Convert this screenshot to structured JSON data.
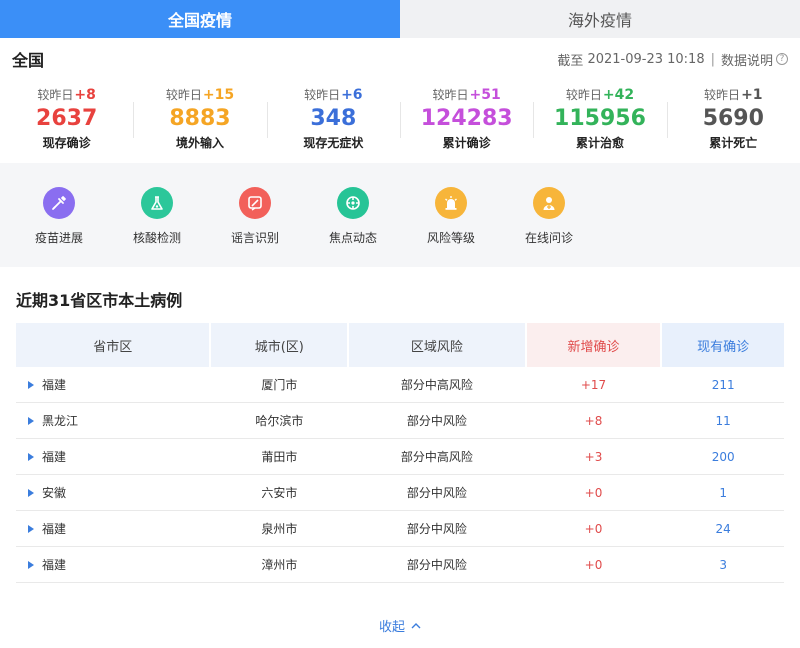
{
  "tabs": [
    {
      "label": "全国疫情",
      "active": true
    },
    {
      "label": "海外疫情",
      "active": false
    }
  ],
  "summary": {
    "region": "全国",
    "update_prefix": "截至",
    "update_time": "2021-09-23 10:18",
    "data_note": "数据说明",
    "delta_prefix": "较昨日"
  },
  "stats": [
    {
      "label": "现存确诊",
      "value": "2637",
      "delta": "+8",
      "color": "#e8423e"
    },
    {
      "label": "境外输入",
      "value": "8883",
      "delta": "+15",
      "color": "#f5a524"
    },
    {
      "label": "现存无症状",
      "value": "348",
      "delta": "+6",
      "color": "#3b6fd9"
    },
    {
      "label": "累计确诊",
      "value": "124283",
      "delta": "+51",
      "color": "#c54fdb"
    },
    {
      "label": "累计治愈",
      "value": "115956",
      "delta": "+42",
      "color": "#33b35a"
    },
    {
      "label": "累计死亡",
      "value": "5690",
      "delta": "+1",
      "color": "#555555"
    }
  ],
  "shortcuts": [
    {
      "label": "疫苗进展",
      "icon": "syringe-icon",
      "color": "#8a6ef0"
    },
    {
      "label": "核酸检测",
      "icon": "flask-icon",
      "color": "#2cc79a"
    },
    {
      "label": "谣言识别",
      "icon": "rumor-icon",
      "color": "#f2605a"
    },
    {
      "label": "焦点动态",
      "icon": "focus-icon",
      "color": "#26c496"
    },
    {
      "label": "风险等级",
      "icon": "alarm-icon",
      "color": "#f7b53a"
    },
    {
      "label": "在线问诊",
      "icon": "doctor-icon",
      "color": "#f7b53a"
    }
  ],
  "table": {
    "title": "近期31省区市本土病例",
    "headers": [
      "省市区",
      "城市(区)",
      "区域风险",
      "新增确诊",
      "现有确诊"
    ],
    "rows": [
      {
        "province": "福建",
        "city": "厦门市",
        "risk": "部分中高风险",
        "new": "+17",
        "current": "211"
      },
      {
        "province": "黑龙江",
        "city": "哈尔滨市",
        "risk": "部分中风险",
        "new": "+8",
        "current": "11"
      },
      {
        "province": "福建",
        "city": "莆田市",
        "risk": "部分中高风险",
        "new": "+3",
        "current": "200"
      },
      {
        "province": "安徽",
        "city": "六安市",
        "risk": "部分中风险",
        "new": "+0",
        "current": "1"
      },
      {
        "province": "福建",
        "city": "泉州市",
        "risk": "部分中风险",
        "new": "+0",
        "current": "24"
      },
      {
        "province": "福建",
        "city": "漳州市",
        "risk": "部分中风险",
        "new": "+0",
        "current": "3"
      }
    ]
  },
  "collapse_label": "收起"
}
